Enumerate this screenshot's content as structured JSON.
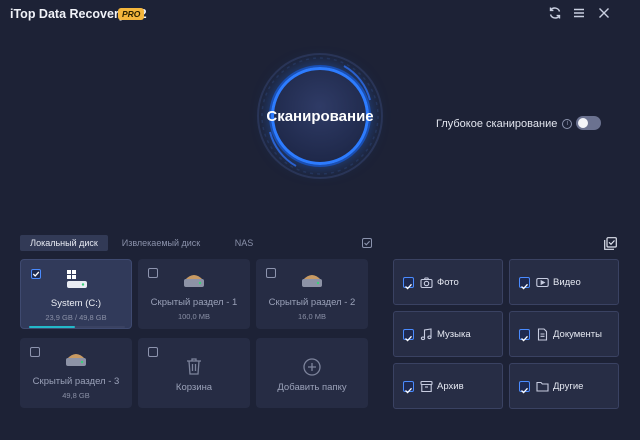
{
  "app": {
    "title": "iTop Data Recovery 6.2",
    "badge": "PRO"
  },
  "scan": {
    "button_label": "Сканирование",
    "deep_scan_label": "Глубокое сканирование",
    "deep_scan_enabled": false
  },
  "tabs": [
    {
      "label": "Локальный диск",
      "active": true
    },
    {
      "label": "Извлекаемый диск",
      "active": false
    },
    {
      "label": "NAS",
      "active": false
    }
  ],
  "drives": [
    {
      "name": "System (C:)",
      "size": "23,9 GB / 49,8 GB",
      "checked": true,
      "usage_fraction": 0.48
    },
    {
      "name": "Скрытый раздел - 1",
      "size": "100,0 MB",
      "checked": false
    },
    {
      "name": "Скрытый раздел - 2",
      "size": "16,0 MB",
      "checked": false
    },
    {
      "name": "Скрытый раздел - 3",
      "size": "49,8 GB",
      "checked": false
    },
    {
      "name": "Корзина",
      "checked": false
    },
    {
      "name": "Добавить папку"
    }
  ],
  "file_types": [
    {
      "label": "Фото",
      "icon": "camera-icon",
      "checked": true
    },
    {
      "label": "Видео",
      "icon": "video-icon",
      "checked": true
    },
    {
      "label": "Музыка",
      "icon": "music-icon",
      "checked": true
    },
    {
      "label": "Документы",
      "icon": "document-icon",
      "checked": true
    },
    {
      "label": "Архив",
      "icon": "archive-icon",
      "checked": true
    },
    {
      "label": "Другие",
      "icon": "folder-icon",
      "checked": true
    }
  ],
  "colors": {
    "accent": "#2d7cff",
    "background": "#1d2236",
    "badge": "#f4b63c",
    "usage_bar": "#23b8c9"
  }
}
